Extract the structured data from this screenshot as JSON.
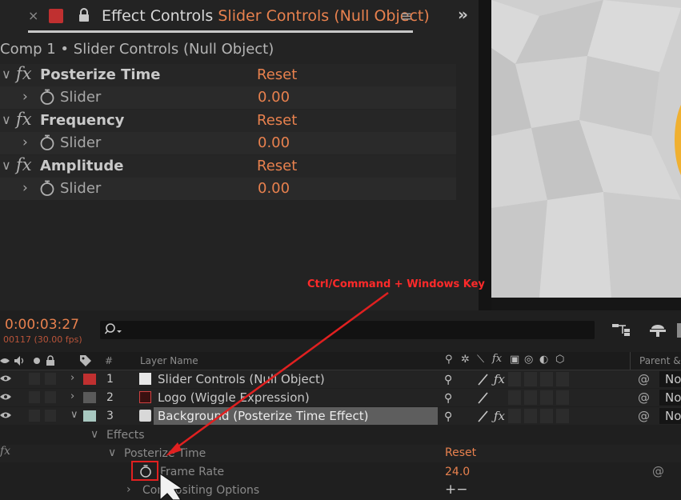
{
  "effect_controls": {
    "close_glyph": "×",
    "title_prefix": "Effect Controls",
    "title_layer": "Slider Controls (Null Object)",
    "menu_glyph": "≡",
    "expand_glyph": "»",
    "comp_label": "Comp 1 • Slider Controls (Null Object)",
    "effects": [
      {
        "name": "Posterize Time",
        "reset": "Reset",
        "slider_label": "Slider",
        "slider_value": "0.00"
      },
      {
        "name": "Frequency",
        "reset": "Reset",
        "slider_label": "Slider",
        "slider_value": "0.00"
      },
      {
        "name": "Amplitude",
        "reset": "Reset",
        "slider_label": "Slider",
        "slider_value": "0.00"
      }
    ],
    "fx_glyph": "fx"
  },
  "timeline": {
    "timecode": "0:00:03:27",
    "frame_info": "00117 (30.00 fps)",
    "headers": {
      "number": "#",
      "layer_name": "Layer Name",
      "parent": "Parent &"
    },
    "layers": [
      {
        "number": "1",
        "name": "Slider Controls (Null Object)",
        "label_color": "#c03030",
        "parent": "No"
      },
      {
        "number": "2",
        "name": "Logo (Wiggle Expression)",
        "label_color": "#5a5a5a",
        "parent": "No"
      },
      {
        "number": "3",
        "name": "Background (Posterize Time Effect)",
        "label_color": "#a8c8c0",
        "parent": "No"
      }
    ],
    "effects_group": "Effects",
    "effect_name": "Posterize Time",
    "effect_reset": "Reset",
    "property_name": "Frame Rate",
    "property_value": "24.0",
    "compositing": "Compositing Options",
    "plus_minus": "+−",
    "fx_label": "fx"
  },
  "annotation": {
    "text": "Ctrl/Command + Windows Key",
    "color": "#ff2a2a"
  },
  "colors": {
    "accent": "#e8814e",
    "panel_bg": "#232323",
    "timeline_bg": "#1f1f1f"
  }
}
